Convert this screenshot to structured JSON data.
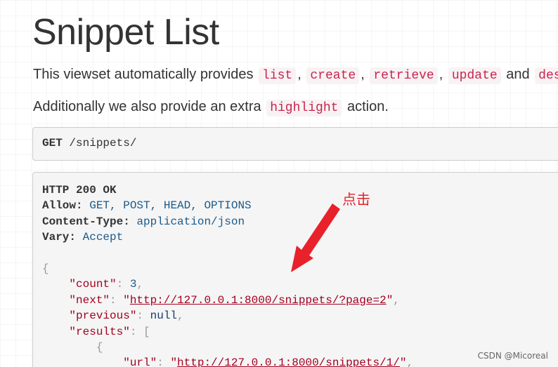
{
  "page": {
    "title": "Snippet List",
    "intro_text": "This viewset automatically provides",
    "actions": [
      "list",
      "create",
      "retrieve",
      "update",
      "des"
    ],
    "separators": [
      ",",
      ",",
      ",",
      "and"
    ],
    "extra_text_before": "Additionally we also provide an extra",
    "extra_action": "highlight",
    "extra_text_after": "action."
  },
  "request": {
    "method": "GET",
    "path": "/snippets/"
  },
  "response": {
    "status": "HTTP 200 OK",
    "headers": [
      {
        "key": "Allow:",
        "value": "GET, POST, HEAD, OPTIONS"
      },
      {
        "key": "Content-Type:",
        "value": "application/json"
      },
      {
        "key": "Vary:",
        "value": "Accept"
      }
    ],
    "body": {
      "open_brace": "{",
      "count_key": "\"count\"",
      "count_value": "3",
      "next_key": "\"next\"",
      "next_url": "http://127.0.0.1:8000/snippets/?page=2",
      "previous_key": "\"previous\"",
      "previous_value": "null",
      "results_key": "\"results\"",
      "results_open": "[",
      "item_open": "{",
      "url_key": "\"url\"",
      "url_value": "http://127.0.0.1:8000/snippets/1/"
    }
  },
  "annotation": {
    "label": "点击",
    "color": "#e8212a"
  },
  "watermark": "CSDN @Micoreal",
  "colors": {
    "code_text": "#c7254e",
    "code_bg": "#f9f2f4",
    "json_string": "#a1001f",
    "json_number": "#1a5a8a",
    "pre_bg": "#f5f5f5"
  }
}
